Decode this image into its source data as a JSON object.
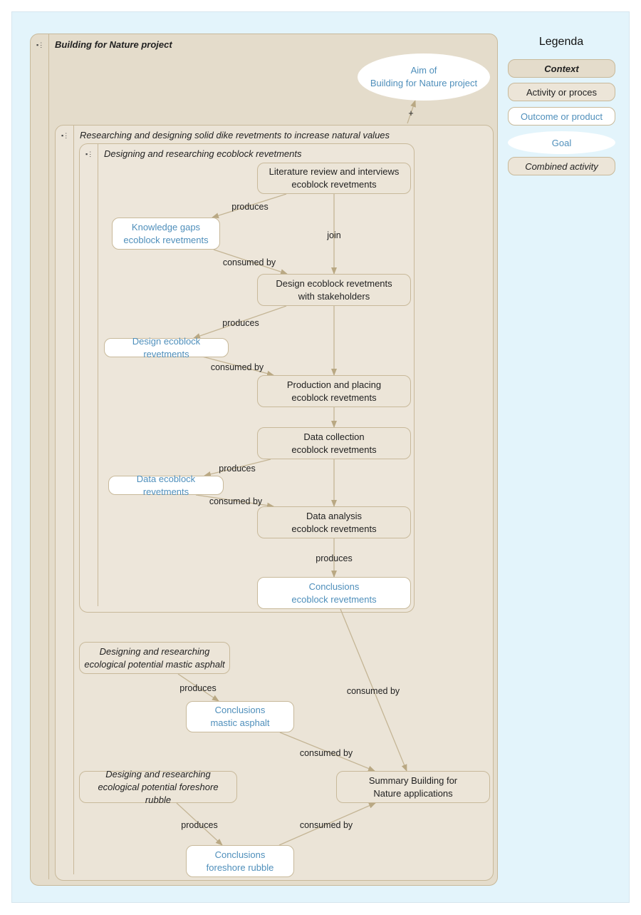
{
  "contexts": {
    "outer": {
      "title": "Building for Nature project"
    },
    "middle": {
      "title": "Researching and designing solid dike revetments to increase natural values"
    },
    "inner": {
      "title": "Designing and researching ecoblock revetments"
    },
    "collapse_icon": "collapse-menu-icon"
  },
  "nodes": {
    "goal": "Aim of\nBuilding for Nature project",
    "literature": "Literature review and interviews\necoblock revetments",
    "knowledge_gaps": "Knowledge gaps\necoblock revetments",
    "design_stakeholders": "Design ecoblock revetments\nwith stakeholders",
    "design_outcome": "Design ecoblock revetments",
    "production": "Production and placing\necoblock revetments",
    "data_collection": "Data collection\necoblock revetments",
    "data_outcome": "Data ecoblock revetments",
    "data_analysis": "Data analysis\necoblock revetments",
    "conclusions_ecoblock": "Conclusions\necoblock revetments",
    "mastic_activity": "Designing and researching\necological potential mastic asphalt",
    "conclusions_mastic": "Conclusions\nmastic asphalt",
    "foreshore_activity": "Desiging and researching\necological potential foreshore rubble",
    "conclusions_foreshore": "Conclusions\nforeshore rubble",
    "summary": "Summary Building for\nNature applications"
  },
  "edges": {
    "plus": "+",
    "lit_produces": "produces",
    "lit_join": "join",
    "gaps_consumed": "consumed by",
    "design_produces": "produces",
    "design_consumed": "consumed by",
    "collection_produces": "produces",
    "data_consumed": "consumed by",
    "analysis_produces": "produces",
    "ecoblock_consumed": "consumed by",
    "mastic_produces": "produces",
    "mastic_consumed": "consumed by",
    "foreshore_produces": "produces",
    "foreshore_consumed": "consumed by"
  },
  "legend": {
    "title": "Legenda",
    "items": [
      "Context",
      "Activity or proces",
      "Outcome or product",
      "Goal",
      "Combined activity"
    ]
  },
  "colors": {
    "background": "#e3f4fb",
    "context_fill": "#e4dccb",
    "border": "#c8b99a",
    "outcome_text": "#4f8fbb"
  }
}
